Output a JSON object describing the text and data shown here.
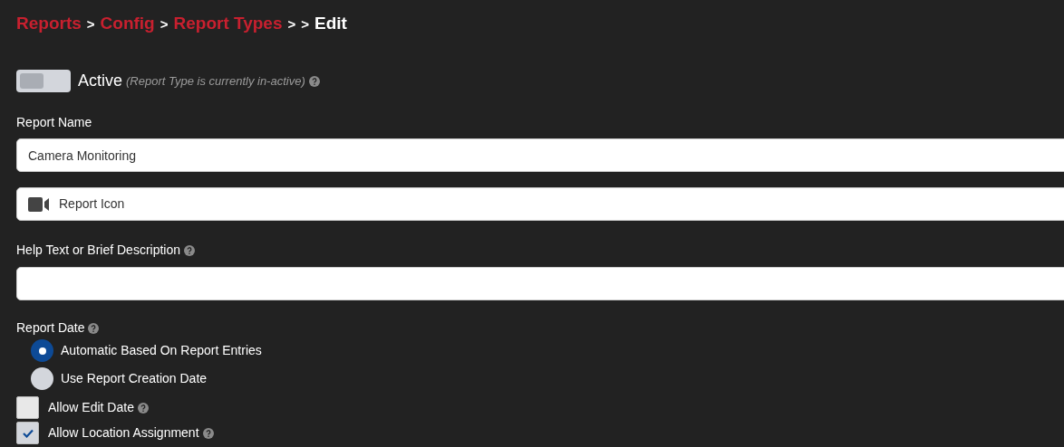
{
  "breadcrumb": [
    {
      "text": "Reports",
      "kind": "link"
    },
    {
      "text": ">",
      "kind": "separator"
    },
    {
      "text": "Config",
      "kind": "link"
    },
    {
      "text": ">",
      "kind": "separator"
    },
    {
      "text": "Report Types",
      "kind": "link"
    },
    {
      "text": ">",
      "kind": "separator"
    },
    {
      "text": ">",
      "kind": "separator"
    },
    {
      "text": "Edit",
      "kind": "current"
    }
  ],
  "active": {
    "label": "Active",
    "note": "(Report Type is currently in-active)",
    "on": false,
    "help": true
  },
  "report_name": {
    "label": "Report Name",
    "value": "Camera Monitoring"
  },
  "report_icon": {
    "value": "Report Icon"
  },
  "help_text": {
    "label": "Help Text or Brief Description",
    "help": true
  },
  "report_date": {
    "label": "Report Date",
    "help": true,
    "options": [
      {
        "label": "Automatic Based On Report Entries",
        "selected": true
      },
      {
        "label": "Use Report Creation Date",
        "selected": false
      }
    ]
  },
  "checkboxes": [
    {
      "label": "Allow Edit Date",
      "checked": false,
      "help": true
    },
    {
      "label": "Allow Location Assignment",
      "checked": true,
      "help": true
    }
  ]
}
